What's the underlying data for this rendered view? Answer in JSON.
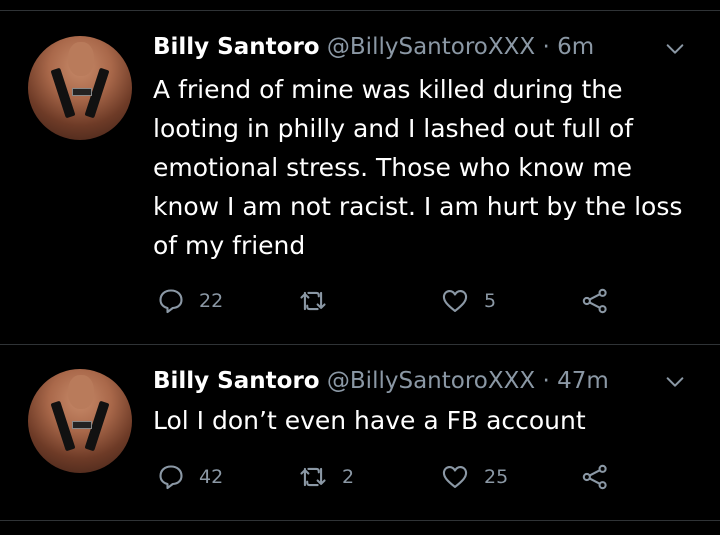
{
  "tweets": [
    {
      "name": "Billy Santoro",
      "handle": "@BillySantoroXXX",
      "separator": "·",
      "time": "6m",
      "text": "A friend of mine was killed during the looting in philly and I lashed out full of emotional stress. Those who know me know I am not racist. I am hurt by the loss of my friend",
      "replies": "22",
      "retweets": "",
      "likes": "5"
    },
    {
      "name": "Billy Santoro",
      "handle": "@BillySantoroXXX",
      "separator": "·",
      "time": "47m",
      "text": "Lol I don’t even have a FB account",
      "replies": "42",
      "retweets": "2",
      "likes": "25"
    }
  ],
  "icons": {
    "reply": "reply-icon",
    "retweet": "retweet-icon",
    "like": "heart-icon",
    "share": "share-icon",
    "more": "chevron-down-icon"
  },
  "colors": {
    "background": "#000000",
    "text": "#ffffff",
    "muted": "#8b98a5",
    "divider": "#2f3336"
  }
}
